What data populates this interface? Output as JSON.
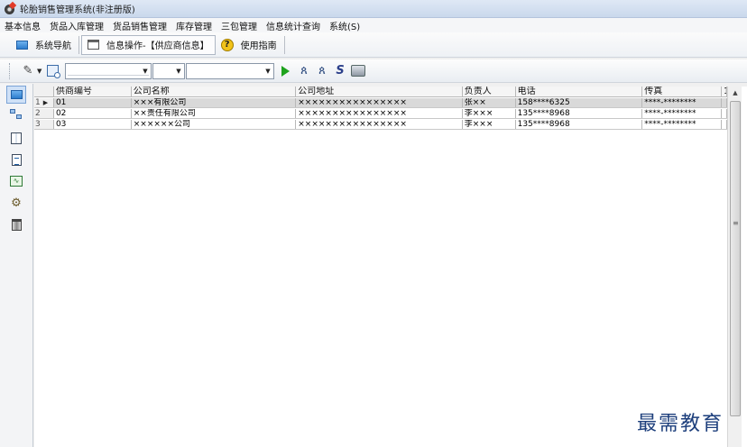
{
  "window": {
    "title": "轮胎销售管理系统(非注册版)"
  },
  "menu": [
    "基本信息",
    "货品入库管理",
    "货品销售管理",
    "库存管理",
    "三包管理",
    "信息统计查询",
    "系统(S)"
  ],
  "tabs": [
    {
      "label": "系统导航",
      "icon": "monitor-icon"
    },
    {
      "label": "信息操作-【供应商信息】",
      "icon": "window-icon"
    },
    {
      "label": "使用指南",
      "icon": "help-icon"
    }
  ],
  "toolbar": {
    "combo1_value": "",
    "combo2_value": "",
    "combo3_value": ""
  },
  "sidebar_icons": [
    "monitor-icon",
    "network-icon",
    "book-icon",
    "document-icon",
    "chart-icon",
    "tools-icon",
    "trash-icon"
  ],
  "table": {
    "columns": [
      "供商编号",
      "公司名称",
      "公司地址",
      "负责人",
      "电话",
      "传真",
      "1"
    ],
    "rows": [
      {
        "idx": "1",
        "code": "01",
        "name": "×××有限公司",
        "address": "××××××××××××××××",
        "person": "张××",
        "phone": "158****6325",
        "fax": "****-********"
      },
      {
        "idx": "2",
        "code": "02",
        "name": "××责任有限公司",
        "address": "××××××××××××××××",
        "person": "李×××",
        "phone": "135****8968",
        "fax": "****-********"
      },
      {
        "idx": "3",
        "code": "03",
        "name": "××××××公司",
        "address": "××××××××××××××××",
        "person": "李×××",
        "phone": "135****8968",
        "fax": "****-********"
      }
    ]
  },
  "watermark": "最需教育"
}
